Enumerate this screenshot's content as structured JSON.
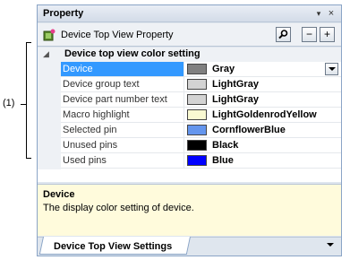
{
  "annotation": {
    "label": "(1)"
  },
  "panel": {
    "title": "Property",
    "pin_glyph": "▾",
    "close_glyph": "×"
  },
  "toolbar": {
    "title": "Device Top View Property",
    "search_icon": "search-icon",
    "collapse_label": "−",
    "expand_label": "+"
  },
  "category": {
    "label": "Device top view color setting"
  },
  "properties": [
    {
      "name": "Device",
      "value": "Gray",
      "color": "#808080",
      "selected": true
    },
    {
      "name": "Device group text",
      "value": "LightGray",
      "color": "#d3d3d3"
    },
    {
      "name": "Device part number text",
      "value": "LightGray",
      "color": "#d3d3d3"
    },
    {
      "name": "Macro highlight",
      "value": "LightGoldenrodYellow",
      "color": "#fafad2"
    },
    {
      "name": "Selected pin",
      "value": "CornflowerBlue",
      "color": "#6495ed"
    },
    {
      "name": "Unused pins",
      "value": "Black",
      "color": "#000000"
    },
    {
      "name": "Used pins",
      "value": "Blue",
      "color": "#0000ff"
    }
  ],
  "description": {
    "title": "Device",
    "text": "The display color setting of device."
  },
  "tabs": [
    {
      "label": "Device Top View Settings"
    }
  ],
  "colors": {
    "selection": "#3399ff",
    "description_bg": "#fffbdc"
  }
}
